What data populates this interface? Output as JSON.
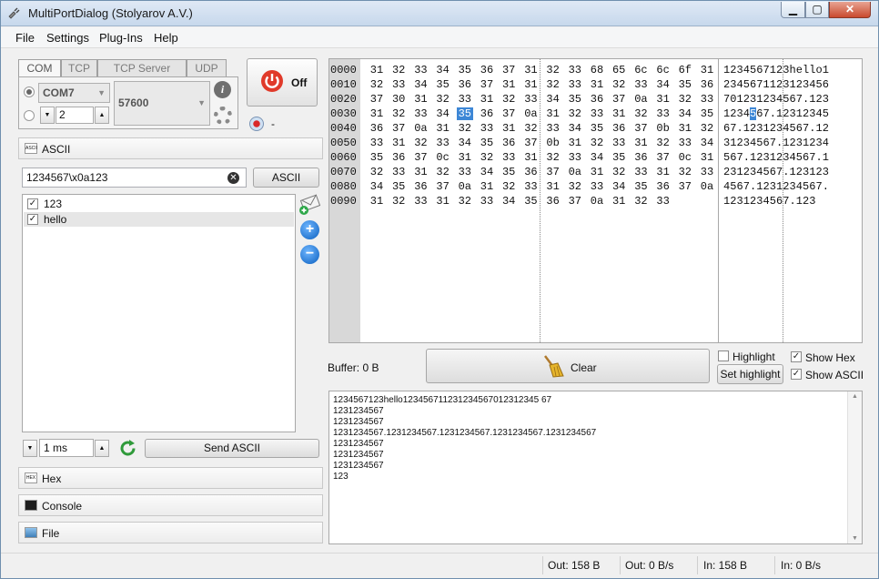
{
  "window": {
    "title": "MultiPortDialog (Stolyarov A.V.)",
    "min_glyph": "▁",
    "max_glyph": "▢",
    "close_glyph": "✕"
  },
  "menu": [
    "File",
    "Settings",
    "Plug-Ins",
    "Help"
  ],
  "connection": {
    "tabs": [
      "COM",
      "TCP",
      "TCP Server",
      "UDP"
    ],
    "port": "COM7",
    "port_index": "2",
    "baud": "57600",
    "power_label": "Off",
    "indicator_label": "-"
  },
  "ascii_section": {
    "title": "ASCII",
    "icon_text": "ASCII",
    "input_value": "1234567\\x0a123",
    "ascii_button": "ASCII",
    "items": [
      {
        "label": "123",
        "checked": "✓"
      },
      {
        "label": "hello",
        "checked": "✓"
      }
    ],
    "interval": "1 ms",
    "send_button": "Send ASCII"
  },
  "sections": {
    "hex": {
      "title": "Hex",
      "icon_text": "HEX"
    },
    "console": {
      "title": "Console"
    },
    "file": {
      "title": "File"
    }
  },
  "hex_view": {
    "offsets": [
      "0000",
      "0010",
      "0020",
      "0030",
      "0040",
      "0050",
      "0060",
      "0070",
      "0080",
      "0090"
    ],
    "rows": [
      [
        "31",
        "32",
        "33",
        "34",
        "35",
        "36",
        "37",
        "31",
        "32",
        "33",
        "68",
        "65",
        "6c",
        "6c",
        "6f",
        "31"
      ],
      [
        "32",
        "33",
        "34",
        "35",
        "36",
        "37",
        "31",
        "31",
        "32",
        "33",
        "31",
        "32",
        "33",
        "34",
        "35",
        "36"
      ],
      [
        "37",
        "30",
        "31",
        "32",
        "33",
        "31",
        "32",
        "33",
        "34",
        "35",
        "36",
        "37",
        "0a",
        "31",
        "32",
        "33"
      ],
      [
        "31",
        "32",
        "33",
        "34",
        "35",
        "36",
        "37",
        "0a",
        "31",
        "32",
        "33",
        "31",
        "32",
        "33",
        "34",
        "35"
      ],
      [
        "36",
        "37",
        "0a",
        "31",
        "32",
        "33",
        "31",
        "32",
        "33",
        "34",
        "35",
        "36",
        "37",
        "0b",
        "31",
        "32"
      ],
      [
        "33",
        "31",
        "32",
        "33",
        "34",
        "35",
        "36",
        "37",
        "0b",
        "31",
        "32",
        "33",
        "31",
        "32",
        "33",
        "34"
      ],
      [
        "35",
        "36",
        "37",
        "0c",
        "31",
        "32",
        "33",
        "31",
        "32",
        "33",
        "34",
        "35",
        "36",
        "37",
        "0c",
        "31"
      ],
      [
        "32",
        "33",
        "31",
        "32",
        "33",
        "34",
        "35",
        "36",
        "37",
        "0a",
        "31",
        "32",
        "33",
        "31",
        "32",
        "33"
      ],
      [
        "34",
        "35",
        "36",
        "37",
        "0a",
        "31",
        "32",
        "33",
        "31",
        "32",
        "33",
        "34",
        "35",
        "36",
        "37",
        "0a"
      ],
      [
        "31",
        "32",
        "33",
        "31",
        "32",
        "33",
        "34",
        "35",
        "36",
        "37",
        "0a",
        "31",
        "32",
        "33"
      ]
    ],
    "ascii_rows": [
      "1234567123hello1",
      "2345671123123456",
      "70123123456 7.123",
      "1234567.12312345",
      "67.1231234567.12",
      "31234567.1231234",
      "567.1231234567.1",
      "2312345 67.123123",
      "4567.1231234567.",
      "1231234567.123"
    ],
    "selected_row": 3,
    "selected_col": 4,
    "selected_ascii_col": 4
  },
  "controls": {
    "buffer": "Buffer: 0 B",
    "clear_button": "Clear",
    "highlight_label": "Highlight",
    "set_highlight_button": "Set highlight",
    "show_hex_label": "Show Hex",
    "show_ascii_label": "Show ASCII",
    "check": "✓"
  },
  "log_lines": [
    "1234567123hello123456711231234567012312345 67",
    "1231234567",
    "1231234567",
    "1231234567.1231234567.1231234567.1231234567.1231234567",
    "1231234567",
    "1231234567",
    "1231234567",
    "123"
  ],
  "status": {
    "out": "Out: 158 B",
    "out_rate": "Out: 0 B/s",
    "in": "In: 158 B",
    "in_rate": "In: 0 B/s"
  }
}
